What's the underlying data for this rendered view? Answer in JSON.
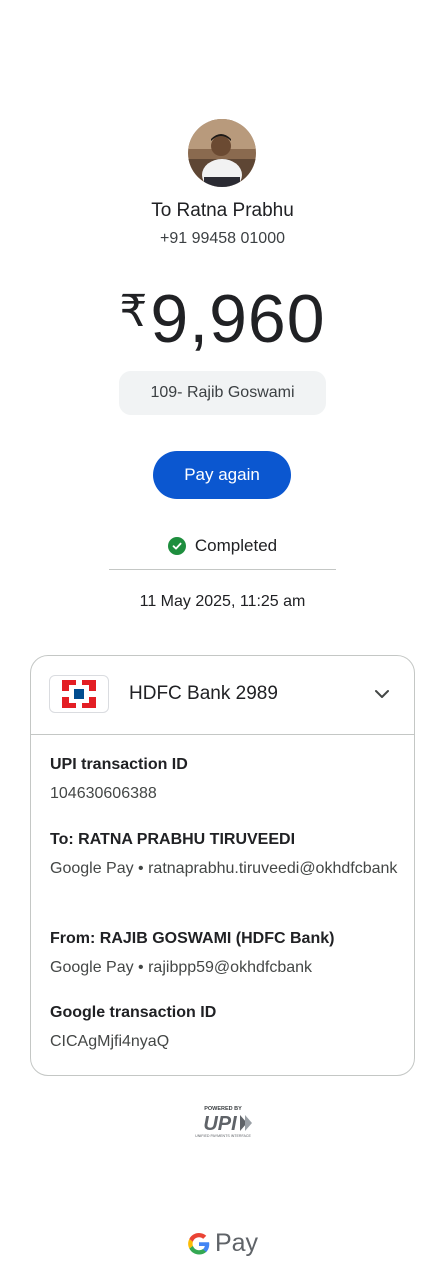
{
  "payee": {
    "name": "To Ratna Prabhu",
    "phone": "+91 99458 01000"
  },
  "amount": {
    "currency_symbol": "₹",
    "value": "9,960"
  },
  "note": "109- Rajib Goswami",
  "actions": {
    "pay_again": "Pay again"
  },
  "status": {
    "label": "Completed",
    "color": "#1e8e3e"
  },
  "datetime": "11 May 2025, 11:25 am",
  "bank": {
    "name": "HDFC Bank 2989",
    "logo_icon": "hdfc-bank-logo"
  },
  "details": {
    "upi_txn": {
      "label": "UPI transaction ID",
      "value": "104630606388"
    },
    "to": {
      "label": "To: RATNA PRABHU TIRUVEEDI",
      "value": "Google Pay • ratnaprabhu.tiruveedi@okhdfcbank"
    },
    "from": {
      "label": "From: RAJIB GOSWAMI (HDFC Bank)",
      "value": "Google Pay • rajibpp59@okhdfcbank"
    },
    "google_txn": {
      "label": "Google transaction ID",
      "value": "CICAgMjfi4nyaQ"
    }
  },
  "footer": {
    "powered_by": "POWERED BY",
    "upi": "UPI",
    "upi_tagline": "UNIFIED PAYMENTS INTERFACE",
    "gpay_label": "Pay"
  },
  "colors": {
    "primary_button": "#0b57d0",
    "hdfc_red": "#e31e24",
    "hdfc_blue": "#004c8f"
  }
}
